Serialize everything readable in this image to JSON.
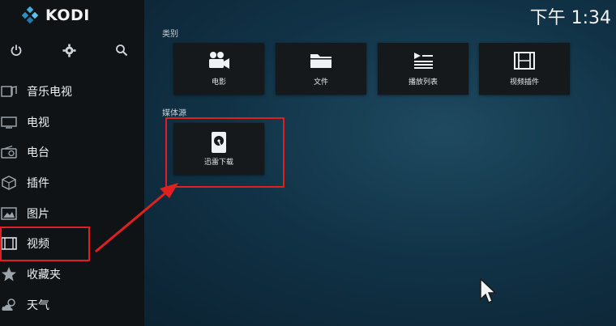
{
  "app": {
    "name": "KODI"
  },
  "clock": "下午 1:34",
  "sidebar": {
    "top_icons": [
      "power-icon",
      "gear-icon",
      "search-icon"
    ],
    "items": [
      {
        "label": "音乐电视",
        "icon": "music-video-icon"
      },
      {
        "label": "电视",
        "icon": "tv-icon"
      },
      {
        "label": "电台",
        "icon": "radio-icon"
      },
      {
        "label": "插件",
        "icon": "addon-box-icon"
      },
      {
        "label": "图片",
        "icon": "picture-icon"
      },
      {
        "label": "视频",
        "icon": "film-strip-icon",
        "highlighted": true
      },
      {
        "label": "收藏夹",
        "icon": "star-icon"
      },
      {
        "label": "天气",
        "icon": "weather-icon"
      }
    ]
  },
  "main": {
    "categories_label": "类别",
    "categories": [
      {
        "label": "电影",
        "icon": "movie-camera-icon"
      },
      {
        "label": "文件",
        "icon": "folder-icon"
      },
      {
        "label": "播放列表",
        "icon": "playlist-icon"
      },
      {
        "label": "视频插件",
        "icon": "film-strip-icon"
      }
    ],
    "sources_label": "媒体源",
    "sources": [
      {
        "label": "迅雷下载",
        "icon": "hard-drive-icon",
        "highlighted": true
      }
    ]
  },
  "annotation": {
    "color": "#e02020"
  }
}
